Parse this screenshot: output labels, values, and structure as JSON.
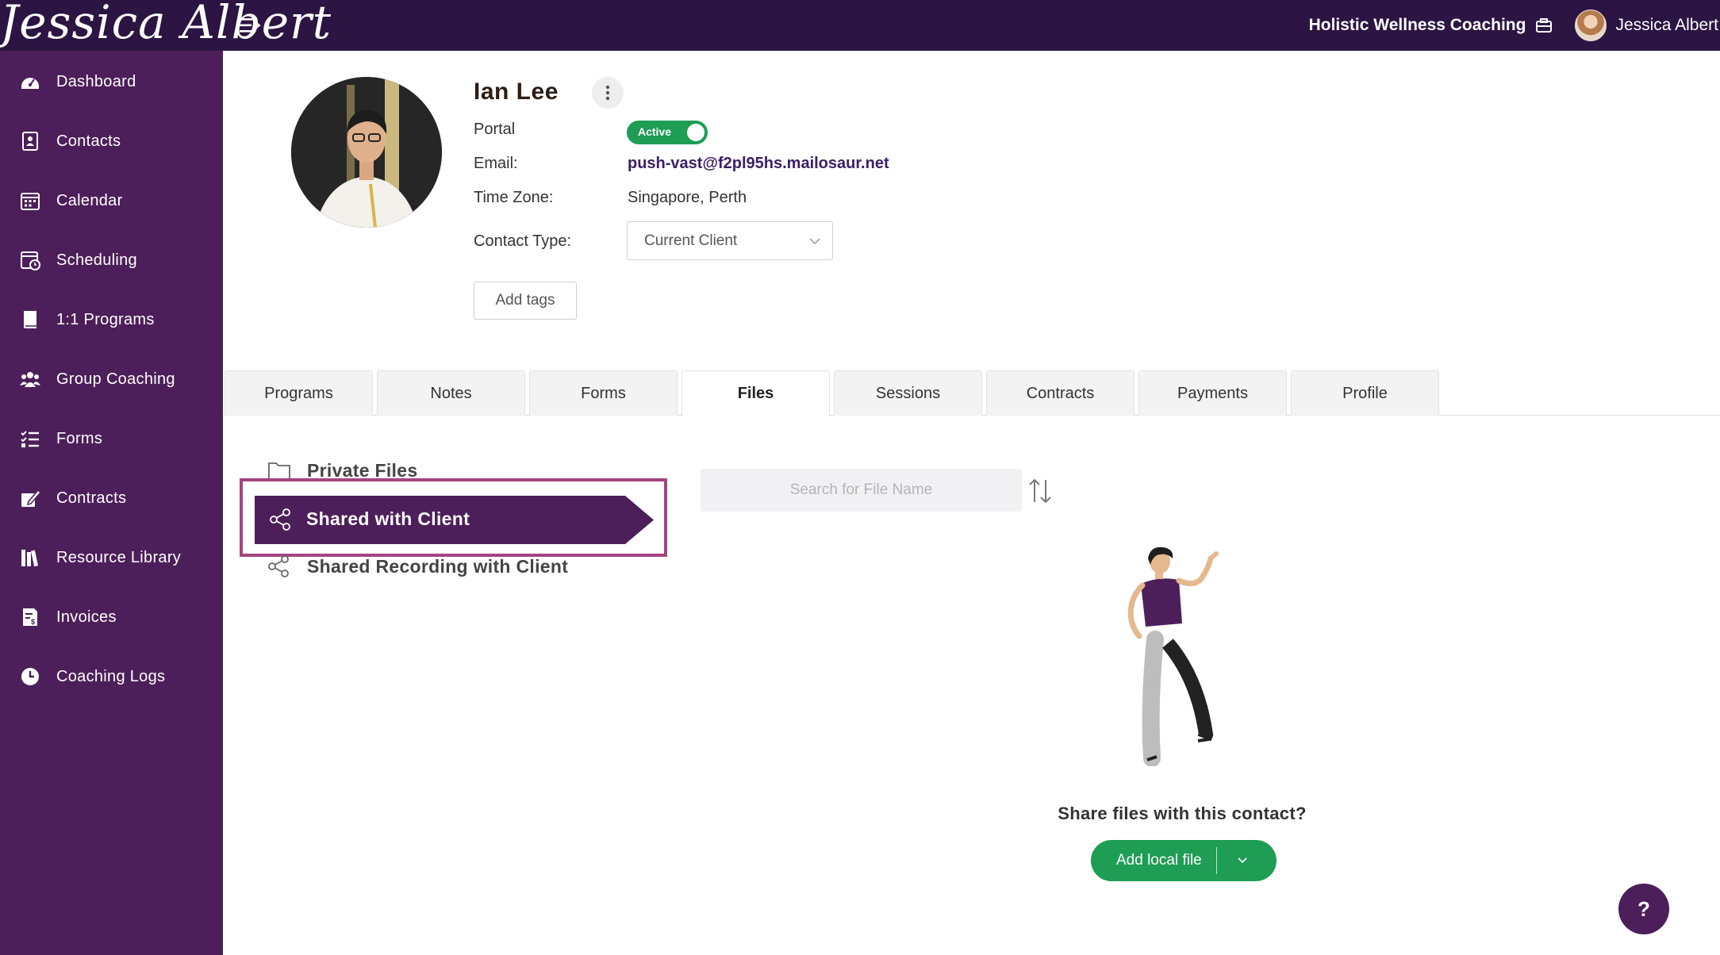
{
  "header": {
    "logo_text": "Jessica Albert",
    "org_name": "Holistic Wellness Coaching",
    "user_name": "Jessica Albert"
  },
  "sidebar": {
    "items": [
      {
        "label": "Dashboard",
        "icon": "dashboard-icon"
      },
      {
        "label": "Contacts",
        "icon": "contacts-icon"
      },
      {
        "label": "Calendar",
        "icon": "calendar-icon"
      },
      {
        "label": "Scheduling",
        "icon": "scheduling-icon"
      },
      {
        "label": "1:1 Programs",
        "icon": "book-icon"
      },
      {
        "label": "Group Coaching",
        "icon": "group-icon"
      },
      {
        "label": "Forms",
        "icon": "forms-icon"
      },
      {
        "label": "Contracts",
        "icon": "contract-icon"
      },
      {
        "label": "Resource Library",
        "icon": "library-icon"
      },
      {
        "label": "Invoices",
        "icon": "invoice-icon"
      },
      {
        "label": "Coaching Logs",
        "icon": "clock-icon"
      }
    ]
  },
  "contact": {
    "name": "Ian Lee",
    "portal_label": "Portal",
    "portal_status": "Active",
    "email_label": "Email:",
    "email": "push-vast@f2pl95hs.mailosaur.net",
    "timezone_label": "Time Zone:",
    "timezone": "Singapore, Perth",
    "contact_type_label": "Contact Type:",
    "contact_type": "Current Client",
    "add_tags": "Add tags"
  },
  "tabs": [
    {
      "label": "Programs",
      "active": false
    },
    {
      "label": "Notes",
      "active": false
    },
    {
      "label": "Forms",
      "active": false
    },
    {
      "label": "Files",
      "active": true
    },
    {
      "label": "Sessions",
      "active": false
    },
    {
      "label": "Contracts",
      "active": false
    },
    {
      "label": "Payments",
      "active": false
    },
    {
      "label": "Profile",
      "active": false
    }
  ],
  "files": {
    "folders": [
      {
        "label": "Private Files",
        "icon": "folder-icon"
      },
      {
        "label": "Shared with Client",
        "icon": "share-icon",
        "selected": true
      },
      {
        "label": "Shared Recording with Client",
        "icon": "share-icon"
      }
    ],
    "search_placeholder": "Search for File Name",
    "empty_prompt": "Share files with this contact?",
    "add_button": "Add local file"
  },
  "help_label": "?",
  "colors": {
    "topbar": "#2c1542",
    "sidebar": "#4d1f5a",
    "accent_green": "#1f9d55",
    "highlight_border": "#a4447f"
  }
}
